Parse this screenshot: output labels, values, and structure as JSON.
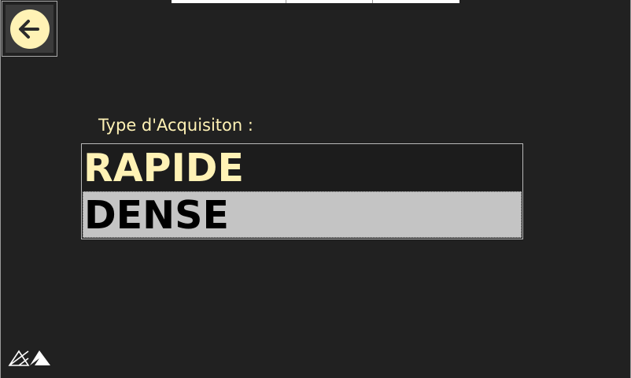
{
  "app": {
    "prompt_label": "Type d'Acquisiton :"
  },
  "back_button": {
    "icon": "arrow-left-circle-icon"
  },
  "acquisition_types": {
    "options": [
      "RAPIDE",
      "DENSE"
    ],
    "selected": "DENSE"
  },
  "logo": {
    "icon": "mountains-logo-icon"
  },
  "colors": {
    "background": "#212121",
    "accent": "#fff2b5",
    "selection": "#c4c4c4"
  }
}
